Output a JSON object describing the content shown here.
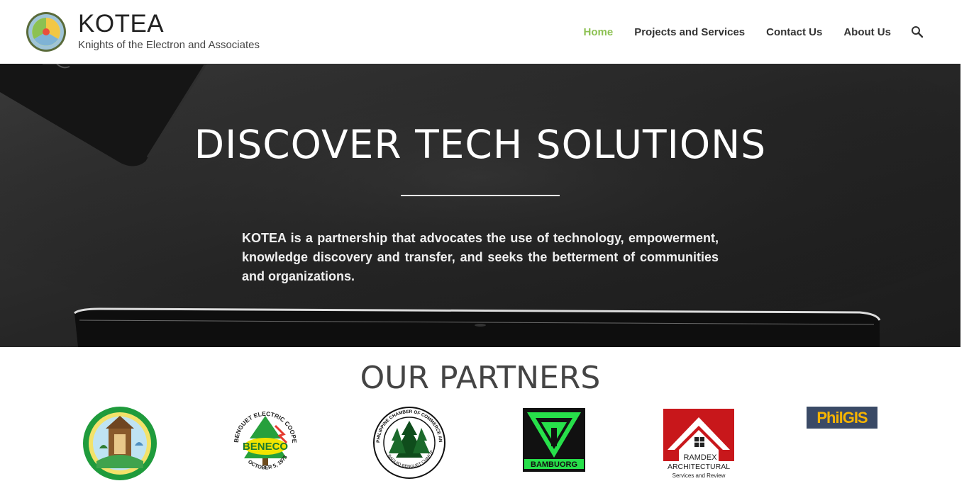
{
  "header": {
    "site_title": "KOTEA",
    "tagline": "Knights of the Electron and Associates",
    "nav": [
      {
        "label": "Home",
        "active": true
      },
      {
        "label": "Projects and Services",
        "active": false
      },
      {
        "label": "Contact Us",
        "active": false
      },
      {
        "label": "About Us",
        "active": false
      }
    ],
    "search_icon": "search-icon",
    "accent": "#8cc152"
  },
  "hero": {
    "title": "DISCOVER TECH SOLUTIONS",
    "text": "KOTEA is a partnership that advocates the use of technology, empowerment, knowledge discovery and transfer, and seeks the betterment of communities and organizations."
  },
  "partners": {
    "title": "OUR PARTNERS",
    "logos": [
      {
        "name": "partner-logo-seal",
        "text": ""
      },
      {
        "name": "partner-logo-beneco",
        "text": "BENECO",
        "ring": "BENGUET ELECTRIC COOPERATIVE INC",
        "date": "OCTOBER 5, 1973"
      },
      {
        "name": "partner-logo-chamber",
        "ring": "PHILIPPINE CHAMBER OF COMMERCE AND INDUSTRY",
        "sub": "BAGUIO-BENGUET CHAPTER"
      },
      {
        "name": "partner-logo-bambuorg",
        "text": "BAMBUORG"
      },
      {
        "name": "partner-logo-ramdex",
        "text": "RAMDEX",
        "sub1": "ARCHITECTURAL",
        "sub2": "Services and Review"
      },
      {
        "name": "partner-logo-philgis",
        "text": "PhilGIS"
      }
    ]
  }
}
